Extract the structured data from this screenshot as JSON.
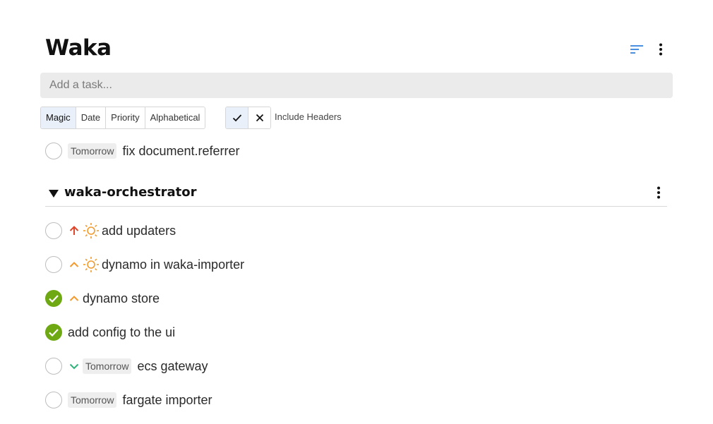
{
  "app": {
    "title": "Waka"
  },
  "header": {
    "sort_icon": "sort-icon",
    "more_icon": "more-vert-icon",
    "accent_color": "#4a8fe0"
  },
  "add_task": {
    "placeholder": "Add a task..."
  },
  "sort_options": [
    {
      "label": "Magic",
      "active": true
    },
    {
      "label": "Date",
      "active": false
    },
    {
      "label": "Priority",
      "active": false
    },
    {
      "label": "Alphabetical",
      "active": false
    }
  ],
  "headers_toggle": {
    "on_icon": "check-icon",
    "off_icon": "close-icon",
    "label": "Include Headers"
  },
  "tasks_top": [
    {
      "completed": false,
      "badge": "Tomorrow",
      "text": "fix document.referrer"
    }
  ],
  "section": {
    "title": "waka-orchestrator",
    "collapse_icon": "triangle-down-icon",
    "more_icon": "more-vert-icon",
    "tasks": [
      {
        "completed": false,
        "priority_icon": "arrow-up-icon",
        "priority_color": "#e0452a",
        "today_icon": "sun-icon",
        "text": "add updaters"
      },
      {
        "completed": false,
        "priority_icon": "chevron-up-icon",
        "priority_color": "#f29a2e",
        "today_icon": "sun-icon",
        "text": "dynamo in waka-importer"
      },
      {
        "completed": true,
        "priority_icon": "chevron-up-icon",
        "priority_color": "#f29a2e",
        "text": "dynamo store"
      },
      {
        "completed": true,
        "text": "add config to the ui"
      },
      {
        "completed": false,
        "priority_icon": "chevron-down-icon",
        "priority_color": "#2fb37a",
        "badge": "Tomorrow",
        "text": "ecs gateway"
      },
      {
        "completed": false,
        "badge": "Tomorrow",
        "text": "fargate importer"
      }
    ]
  },
  "colors": {
    "done_green": "#6ea812",
    "sun_orange": "#f29a2e",
    "active_bg": "#e9f0fa"
  }
}
